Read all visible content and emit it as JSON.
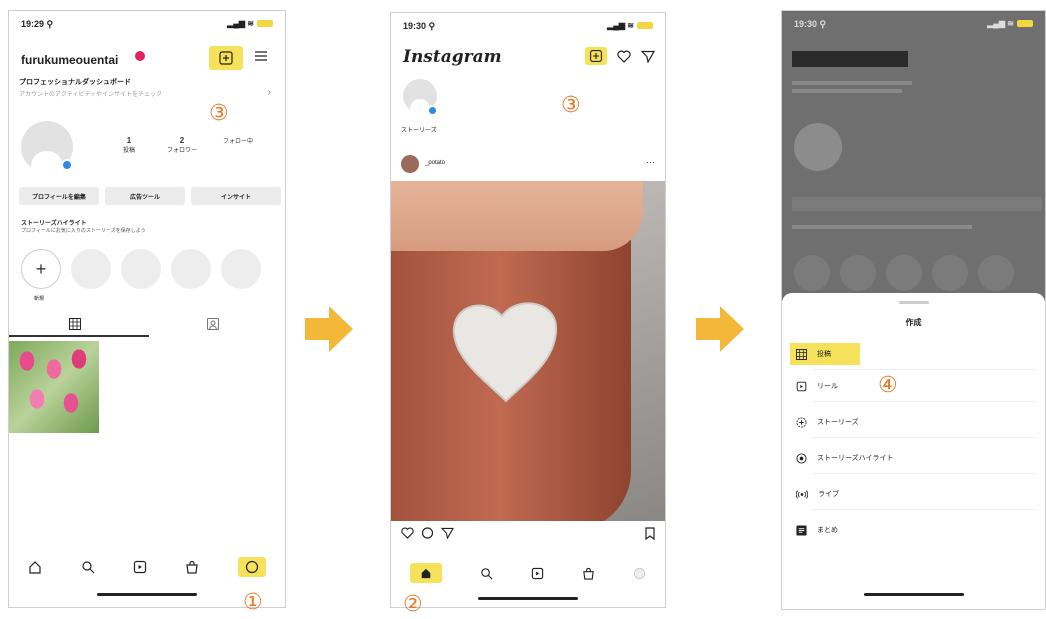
{
  "colors": {
    "highlight": "#f6e25a",
    "step_number": "#e87a2e",
    "arrow": "#f3b83a",
    "blue": "#2b8be5"
  },
  "step_numbers": {
    "s1": "①",
    "s2": "②",
    "s3a": "③",
    "s3b": "③",
    "s4": "④"
  },
  "phone1": {
    "status": {
      "time": "19:29 ⚲",
      "signal": "▂▄▆ ≋"
    },
    "username": "furukumeouentai",
    "pro_dashboard": {
      "title": "プロフェッショナルダッシュボード",
      "subtitle": "アカウントのアクティビティやインサイトをチェック"
    },
    "stats": [
      {
        "num": "1",
        "label": "投稿"
      },
      {
        "num": "2",
        "label": "フォロワー"
      },
      {
        "num": "",
        "label": "フォロー中"
      }
    ],
    "buttons": [
      "プロフィールを編集",
      "広告ツール",
      "インサイト"
    ],
    "highlights": {
      "title": "ストーリーズハイライト",
      "subtitle": "プロフィールにお気に入りのストーリーズを保存しよう",
      "new_label": "新規"
    }
  },
  "phone2": {
    "status": {
      "time": "19:30 ⚲",
      "signal": "▂▄▆ ≋"
    },
    "logo": "Instagram",
    "your_story": "ストーリーズ",
    "post_user": "_potato"
  },
  "phone3": {
    "status": {
      "time": "19:30 ⚲",
      "signal": "▂▄▆ ≋"
    },
    "sheet_title": "作成",
    "menu": [
      {
        "icon": "grid-post-icon",
        "label": "投稿"
      },
      {
        "icon": "reel-icon",
        "label": "リール"
      },
      {
        "icon": "story-plus-icon",
        "label": "ストーリーズ"
      },
      {
        "icon": "highlight-icon",
        "label": "ストーリーズハイライト"
      },
      {
        "icon": "live-icon",
        "label": "ライブ"
      },
      {
        "icon": "guide-icon",
        "label": "まとめ"
      }
    ]
  }
}
